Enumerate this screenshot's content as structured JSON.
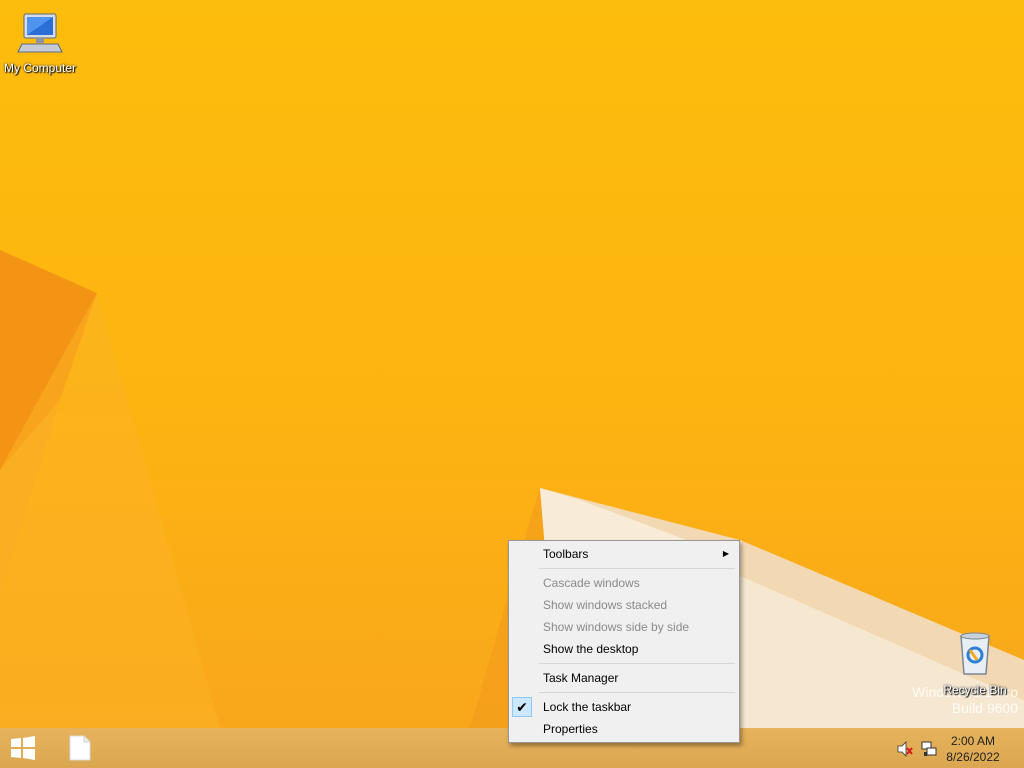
{
  "desktop": {
    "icons": [
      {
        "label": "My Computer",
        "icon": "computer-icon"
      },
      {
        "label": "Recycle Bin",
        "icon": "recycle-bin-icon"
      }
    ],
    "watermark": {
      "line1": "Windows 8.1 Pro",
      "line2": "Build 9600"
    }
  },
  "context_menu": {
    "items": [
      {
        "label": "Toolbars",
        "enabled": true,
        "has_submenu": true
      },
      {
        "label": "Cascade windows",
        "enabled": false
      },
      {
        "label": "Show windows stacked",
        "enabled": false
      },
      {
        "label": "Show windows side by side",
        "enabled": false
      },
      {
        "label": "Show the desktop",
        "enabled": true
      },
      {
        "label": "Task Manager",
        "enabled": true
      },
      {
        "label": "Lock the taskbar",
        "enabled": true,
        "checked": true
      },
      {
        "label": "Properties",
        "enabled": true
      }
    ]
  },
  "taskbar": {
    "start_icon": "windows-logo-icon",
    "pinned_icon": "document-icon",
    "tray": {
      "volume_icon": "volume-muted-icon",
      "network_icon": "network-icon"
    },
    "clock": {
      "time": "2:00 AM",
      "date": "8/26/2022"
    }
  },
  "colors": {
    "wallpaper": "#fdb80e",
    "taskbar": "#e0ab55",
    "menu_bg": "#f0f0f0",
    "check_highlight": "#cce8ff"
  }
}
